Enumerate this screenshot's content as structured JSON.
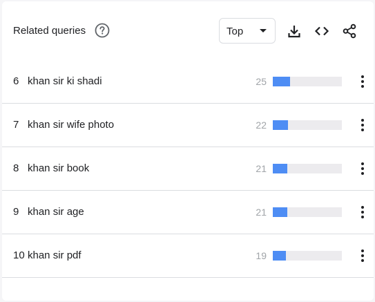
{
  "widget": {
    "title": "Related queries",
    "help_icon": "help-circle-icon",
    "sort_select": {
      "value": "Top"
    },
    "tools": [
      "download-icon",
      "embed-code-icon",
      "share-icon"
    ]
  },
  "rows": [
    {
      "rank": "6",
      "query": "khan sir ki shadi",
      "score": "25",
      "fill_pct": 25
    },
    {
      "rank": "7",
      "query": "khan sir wife photo",
      "score": "22",
      "fill_pct": 22
    },
    {
      "rank": "8",
      "query": "khan sir book",
      "score": "21",
      "fill_pct": 21
    },
    {
      "rank": "9",
      "query": "khan sir age",
      "score": "21",
      "fill_pct": 21
    },
    {
      "rank": "10",
      "query": "khan sir pdf",
      "score": "19",
      "fill_pct": 19
    }
  ],
  "colors": {
    "bar_fill": "#4e8df4",
    "bar_track": "#ecebee",
    "score_text": "#a0a4a8"
  }
}
